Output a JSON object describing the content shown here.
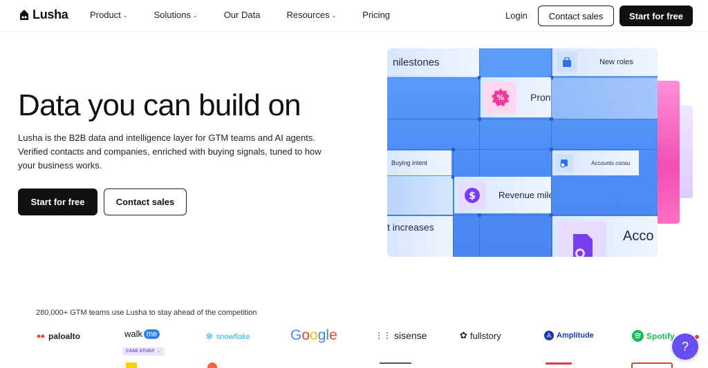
{
  "nav": {
    "brand": "Lusha",
    "links": [
      {
        "label": "Product",
        "has_dropdown": true
      },
      {
        "label": "Solutions",
        "has_dropdown": true
      },
      {
        "label": "Our Data",
        "has_dropdown": false
      },
      {
        "label": "Resources",
        "has_dropdown": true
      },
      {
        "label": "Pricing",
        "has_dropdown": false
      }
    ],
    "login": "Login",
    "contact_sales": "Contact sales",
    "start_free": "Start for free"
  },
  "hero": {
    "title": "Data you can build on",
    "subtitle": "Lusha is the B2B data and intelligence layer for GTM teams and AI agents. Verified contacts and companies, enriched with buying signals, tuned to how your business works.",
    "primary_cta": "Start for free",
    "secondary_cta": "Contact sales"
  },
  "visual": {
    "labels": {
      "milestones": "nilestones",
      "new_roles": "New roles",
      "promo": "Pron",
      "buying_intent": "Buying intent",
      "accounts": "Accounts consu",
      "revenue": "Revenue mile",
      "increases": "t increases",
      "acco": "Acco"
    },
    "icons": [
      "bag-icon",
      "percent-badge-icon",
      "chat-icon",
      "dollar-icon",
      "document-icon"
    ]
  },
  "logos": {
    "caption": "280,000+ GTM teams use Lusha to stay ahead of the competition",
    "items": [
      "paloalto",
      "walkme",
      "snowflake",
      "Google",
      "sisense",
      "fullstory",
      "Amplitude",
      "Spotify"
    ],
    "walkme_prefix": "walk",
    "walkme_suffix": "me",
    "case_study": "CASE STUDY",
    "google_letters": [
      "G",
      "o",
      "o",
      "g",
      "l",
      "e"
    ]
  },
  "help": "?",
  "colors": {
    "dark": "#111111",
    "visual_blue": "#4f8ef5",
    "pink": "#f24fb3",
    "help_purple": "#6a4df0",
    "amplitude": "#1e3aa8",
    "spotify": "#1db954"
  }
}
